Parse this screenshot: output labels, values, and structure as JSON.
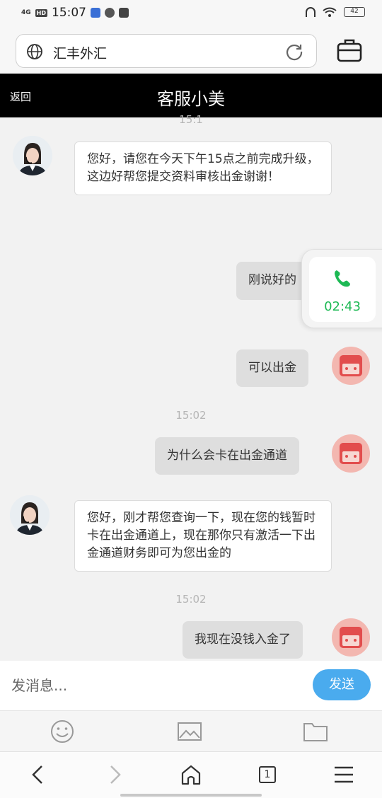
{
  "status_bar": {
    "network": "4G",
    "hd": "HD",
    "time": "15:07",
    "battery": "42"
  },
  "browser": {
    "url_text": "汇丰外汇"
  },
  "chat": {
    "back_label": "返回",
    "title": "客服小美"
  },
  "messages": {
    "ts_top": "15:1",
    "m1": "您好，请您在今天下午15点之前完成升级，这边好帮您提交资料审核出金谢谢！",
    "m2": "刚说好的",
    "m3": "可以出金",
    "ts2": "15:02",
    "m4": "为什么会卡在出金通道",
    "m5": "您好，刚才帮您查询一下，现在您的钱暂时卡在出金通道上，现在那你只有激活一下出金通道财务即可为您出金的",
    "ts3": "15:02",
    "m6": "我现在没钱入金了"
  },
  "call_widget": {
    "duration": "02:43",
    "accent": "#1db954"
  },
  "input": {
    "placeholder": "发消息...",
    "send_label": "发送",
    "send_color": "#4aabee"
  },
  "nav": {
    "tabs_count": "1"
  },
  "icons": [
    "globe-icon",
    "reload-icon",
    "briefcase-icon",
    "phone-icon",
    "emoji-icon",
    "image-icon",
    "folder-icon",
    "back-arrow-icon",
    "forward-arrow-icon",
    "home-icon",
    "tabs-icon",
    "menu-icon"
  ]
}
